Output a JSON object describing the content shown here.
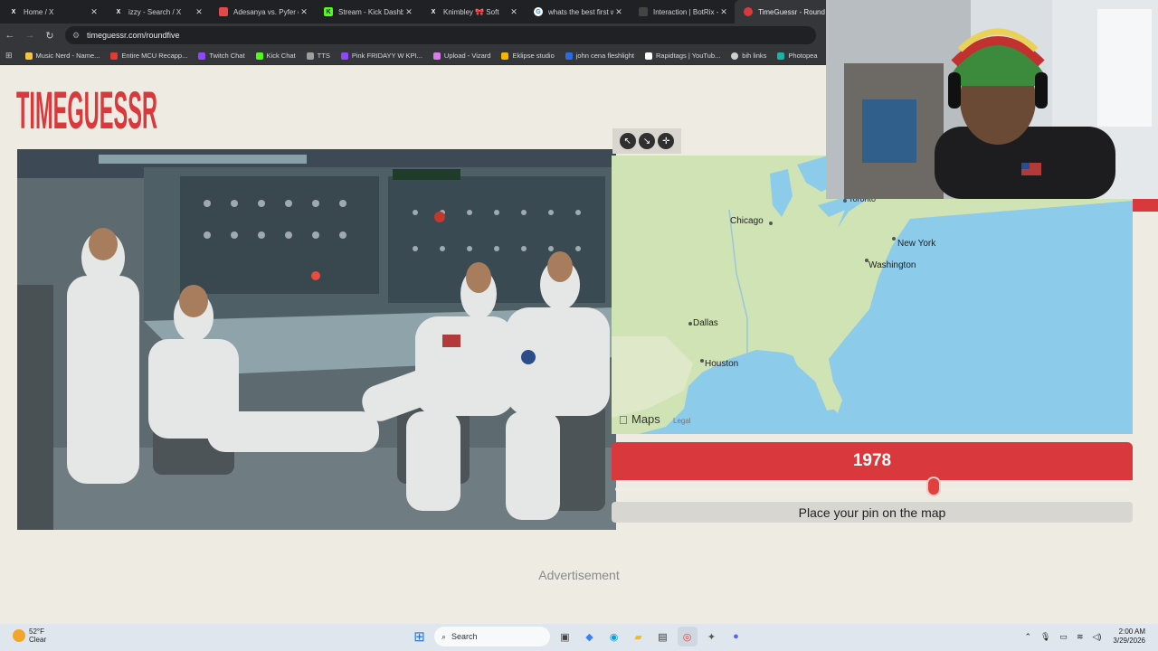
{
  "browser": {
    "tabs": [
      {
        "title": "Home / X",
        "favicon": "x-logo-icon",
        "color": "#ffffff"
      },
      {
        "title": "izzy - Search / X",
        "favicon": "x-logo-icon",
        "color": "#ffffff"
      },
      {
        "title": "Adesanya vs. Pyfer od",
        "favicon": "bookmark-icon",
        "color": "#e24a4a"
      },
      {
        "title": "Stream - Kick Dashbo",
        "favicon": "kick-icon",
        "color": "#53fc18"
      },
      {
        "title": "Knimbley 🎀 Soft",
        "favicon": "x-logo-icon",
        "color": "#ffffff"
      },
      {
        "title": "whats the best first w",
        "favicon": "google-icon",
        "color": "#ffffff"
      },
      {
        "title": "Interaction | BotRix -",
        "favicon": "botrix-icon",
        "color": "#1f1f1f"
      },
      {
        "title": "TimeGuessr - Round",
        "favicon": "timeguessr-icon",
        "color": "#d9393d"
      }
    ],
    "url": "timeguessr.com/roundfive",
    "bookmarks": [
      {
        "label": "Music Nerd - Name...",
        "color": "#f4c542"
      },
      {
        "label": "Entire MCU Recapp...",
        "color": "#e53935"
      },
      {
        "label": "Twitch Chat",
        "color": "#9146ff"
      },
      {
        "label": "Kick Chat",
        "color": "#53fc18"
      },
      {
        "label": "TTS",
        "color": "#9e9e9e"
      },
      {
        "label": "Pink FRIDAYY W KPI...",
        "color": "#9146ff"
      },
      {
        "label": "Upload - Vizard",
        "color": "#d97be8"
      },
      {
        "label": "Eklipse studio",
        "color": "#f5b700"
      },
      {
        "label": "john cena fleshlight",
        "color": "#2d6cdf"
      },
      {
        "label": "Rapidtags | YouTub...",
        "color": "#ffffff"
      },
      {
        "label": "bih links",
        "color": "#cfcfcf"
      },
      {
        "label": "Photopea",
        "color": "#1bb3a6"
      }
    ]
  },
  "game": {
    "logo_text": "TIMEGUESSR",
    "year": "1978",
    "year_fraction": 0.62,
    "place_pin_label": "Place your pin on the map",
    "advertisement": "Advertisement"
  },
  "map": {
    "cities": [
      "Toronto",
      "Chicago",
      "New York",
      "Washington",
      "Dallas",
      "Houston"
    ],
    "maps_brand": "Maps",
    "legal": "Legal",
    "controls": [
      "expand-icon",
      "shrink-icon",
      "pin-icon"
    ]
  },
  "taskbar": {
    "weather_temp": "52°F",
    "weather_desc": "Clear",
    "search_label": "Search",
    "time": "2:00 AM",
    "date": "3/29/2026"
  }
}
